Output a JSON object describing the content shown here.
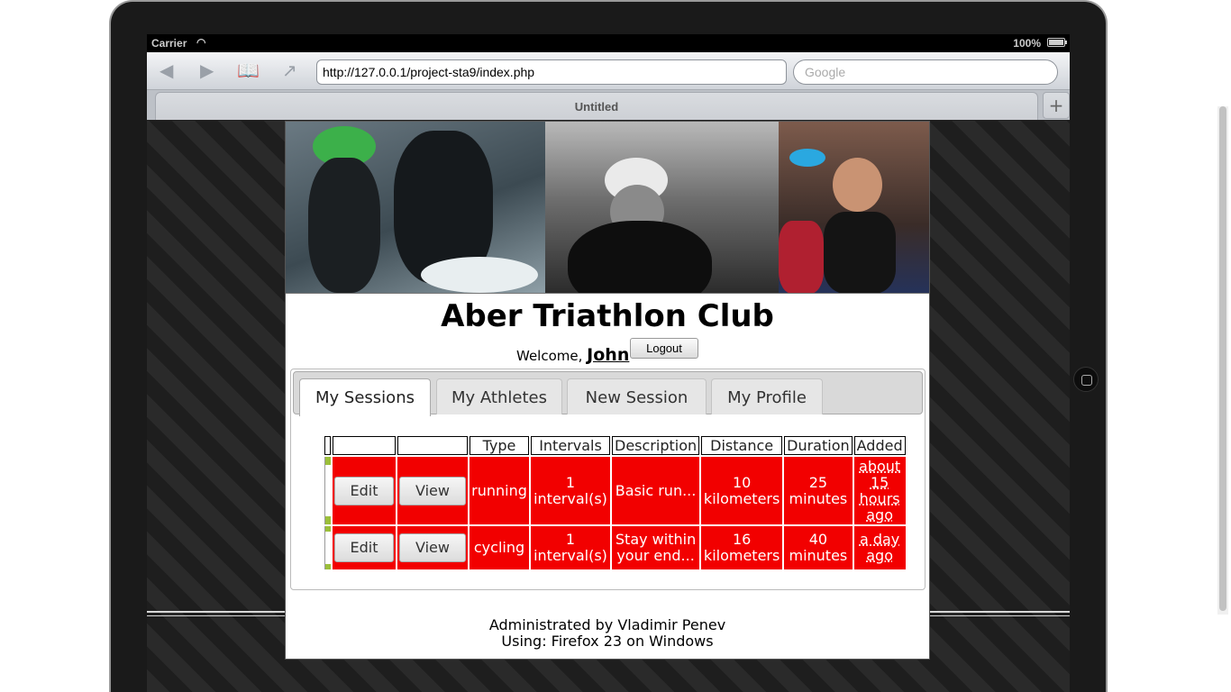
{
  "statusbar": {
    "carrier": "Carrier",
    "battery": "100%"
  },
  "browser": {
    "url": "http://127.0.0.1/project-sta9/index.php",
    "search_placeholder": "Google",
    "tab_title": "Untitled"
  },
  "site": {
    "title": "Aber Triathlon Club",
    "welcome_prefix": "Welcome,",
    "user_name": "John",
    "logout_label": "Logout"
  },
  "tabs": [
    {
      "label": "My Sessions",
      "active": true
    },
    {
      "label": "My Athletes",
      "active": false
    },
    {
      "label": "New Session",
      "active": false
    },
    {
      "label": "My Profile",
      "active": false
    }
  ],
  "table": {
    "headers": [
      "",
      "",
      "Type",
      "Intervals",
      "Description",
      "Distance",
      "Duration",
      "Added"
    ],
    "rows": [
      {
        "edit": "Edit",
        "view": "View",
        "type": "running",
        "intervals": "1 interval(s)",
        "description": "Basic run...",
        "distance": "10 kilometers",
        "duration": "25 minutes",
        "added": "about 15 hours ago"
      },
      {
        "edit": "Edit",
        "view": "View",
        "type": "cycling",
        "intervals": "1 interval(s)",
        "description": "Stay within your end...",
        "distance": "16 kilometers",
        "duration": "40 minutes",
        "added": "a day ago"
      }
    ]
  },
  "footer": {
    "line1": "Administrated by Vladimir Penev",
    "line2": "Using: Firefox 23 on Windows"
  },
  "colors": {
    "row_bg": "#f20000",
    "page_bg": "#222222"
  }
}
